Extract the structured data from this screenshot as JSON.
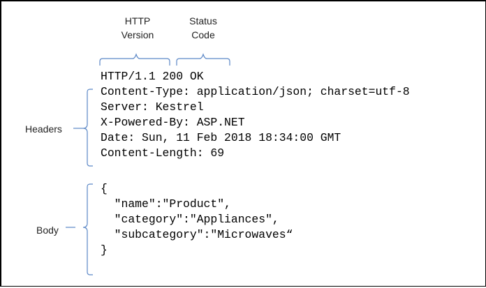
{
  "callouts": {
    "http_version": [
      "HTTP",
      "Version"
    ],
    "status_code": [
      "Status",
      "Code"
    ],
    "headers": "Headers",
    "body": "Body"
  },
  "status_line": "HTTP/1.1 200 OK",
  "headers": [
    "Content-Type: application/json; charset=utf-8",
    "Server: Kestrel",
    "X-Powered-By: ASP.NET",
    "Date: Sun, 11 Feb 2018 18:34:00 GMT",
    "Content-Length: 69"
  ],
  "body_lines": [
    "{",
    "  \"name\":\"Product\",",
    "  \"category\":\"Appliances\",",
    "  \"subcategory\":\"Microwaves“",
    "}"
  ],
  "colors": {
    "bracket": "#5b87c6",
    "text": "#000000",
    "border": "#000000"
  }
}
